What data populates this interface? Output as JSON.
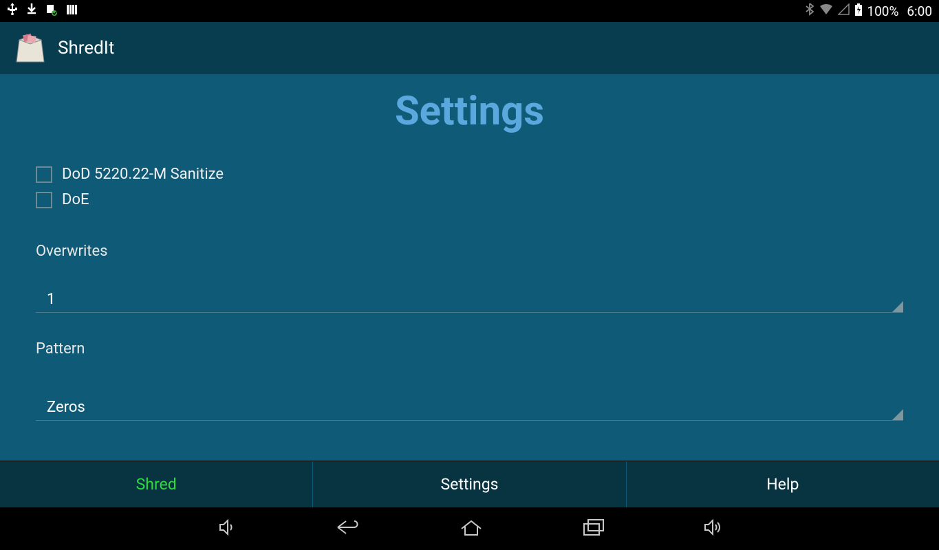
{
  "statusbar": {
    "battery_text": "100%",
    "time": "6:00"
  },
  "titlebar": {
    "app_name": "ShredIt"
  },
  "page": {
    "title": "Settings",
    "checkboxes": [
      {
        "label": "DoD 5220.22-M Sanitize",
        "checked": false
      },
      {
        "label": "DoE",
        "checked": false
      }
    ],
    "overwrites_label": "Overwrites",
    "overwrites_value": "1",
    "pattern_label": "Pattern",
    "pattern_value": "Zeros"
  },
  "tabs": {
    "shred": "Shred",
    "settings": "Settings",
    "help": "Help"
  }
}
